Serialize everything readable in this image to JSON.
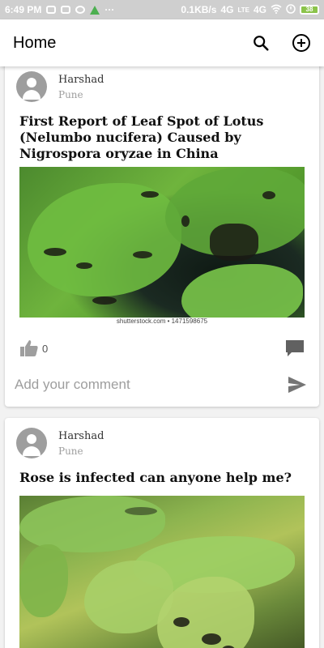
{
  "status_bar": {
    "time": "6:49 PM",
    "network_speed": "0.1KB/s",
    "signal_1": "4G",
    "signal_2": "4G",
    "lte": "LTE",
    "battery": "38"
  },
  "app_bar": {
    "title": "Home",
    "search_icon": "search-icon",
    "add_icon": "add-circle-icon"
  },
  "posts": [
    {
      "user": "Harshad",
      "location": "Pune",
      "title": "First Report of Leaf Spot of Lotus (Nelumbo nucifera) Caused by Nigrospora oryzae in China",
      "image_description": "lotus leaves with dark leaf spots",
      "image_caption": "shutterstock.com • 1471598675",
      "likes": "0",
      "comment_placeholder": "Add your comment"
    },
    {
      "user": "Harshad",
      "location": "Pune",
      "title": "Rose is infected can anyone help me?",
      "image_description": "rose leaves with black spot infection"
    }
  ],
  "colors": {
    "status_bar": "#cfcfcf",
    "app_bar": "#ffffff",
    "background": "#f2f2f2",
    "icon_gray": "#757575"
  }
}
